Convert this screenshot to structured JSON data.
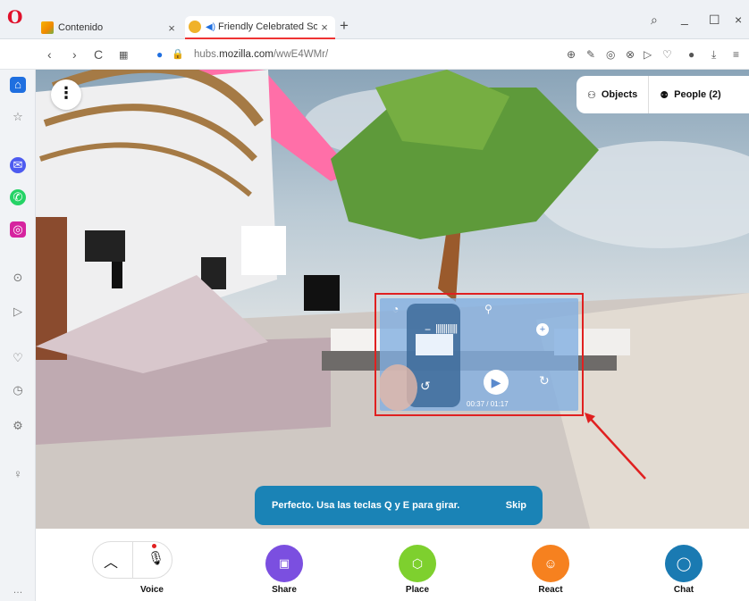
{
  "browser": {
    "tabs": [
      {
        "title": "Contenido",
        "active": false
      },
      {
        "title": "Friendly Celebrated Sol",
        "active": true
      }
    ],
    "url_prefix": "hubs.",
    "url_domain": "mozilla.com",
    "url_path": "/wwE4WMr/"
  },
  "hubs": {
    "objects_label": "Objects",
    "people_label": "People (2)",
    "toast_message": "Perfecto. Usa las teclas Q y E para girar.",
    "toast_skip": "Skip",
    "video_time": "00:37 / 01:17",
    "bottom_buttons": [
      {
        "label": "Voice",
        "color": "#ffffff"
      },
      {
        "label": "Share",
        "color": "#7b4fe0"
      },
      {
        "label": "Place",
        "color": "#7ed02e"
      },
      {
        "label": "React",
        "color": "#f6811f"
      },
      {
        "label": "Chat",
        "color": "#1a7ab2"
      }
    ]
  },
  "colors": {
    "highlight": "#e02020",
    "toast": "#1a83b6",
    "opera_red": "#e0112b"
  }
}
